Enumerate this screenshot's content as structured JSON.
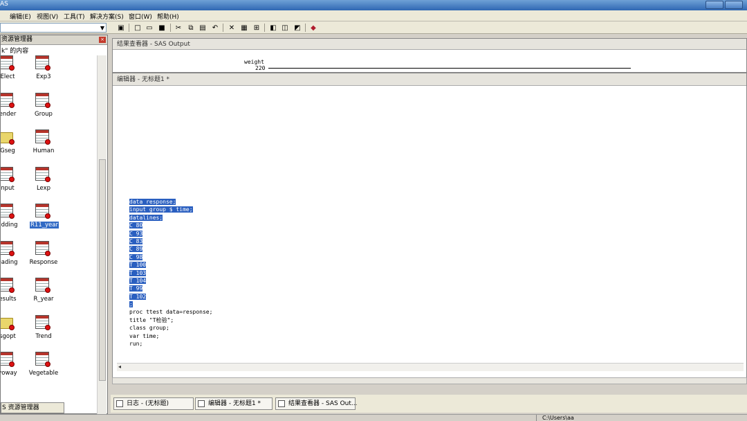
{
  "window": {
    "title": "AS"
  },
  "menu": [
    "编辑(E)",
    "视图(V)",
    "工具(T)",
    "解决方案(S)",
    "窗口(W)",
    "帮助(H)"
  ],
  "explorer": {
    "title": "资源管理器",
    "subtitle": "k\" 的内容",
    "tab": "S 资源管理器",
    "items": [
      {
        "label": "Elect",
        "icon": "table"
      },
      {
        "label": "Exp3",
        "icon": "table"
      },
      {
        "label": "ender",
        "icon": "table"
      },
      {
        "label": "Group",
        "icon": "table"
      },
      {
        "label": "Gseg",
        "icon": "folder"
      },
      {
        "label": "Human",
        "icon": "table"
      },
      {
        "label": "nput",
        "icon": "table"
      },
      {
        "label": "Lexp",
        "icon": "table"
      },
      {
        "label": "adding",
        "icon": "table"
      },
      {
        "label": "R11_year",
        "icon": "table",
        "selected": true
      },
      {
        "label": "eading",
        "icon": "table"
      },
      {
        "label": "Response",
        "icon": "table"
      },
      {
        "label": "esults",
        "icon": "table"
      },
      {
        "label": "R_year",
        "icon": "table"
      },
      {
        "label": "sgopt",
        "icon": "folder"
      },
      {
        "label": "Trend",
        "icon": "table"
      },
      {
        "label": "voway",
        "icon": "table"
      },
      {
        "label": "Vegetable",
        "icon": "table"
      }
    ]
  },
  "output_window": {
    "title": "结果查看器 - SAS Output",
    "var_label": "weight",
    "value": "220"
  },
  "editor_window": {
    "title": "编辑器 - 无标题1 *",
    "lines": [
      {
        "text": "data response;",
        "selected": true
      },
      {
        "text": "input group $ time;",
        "selected": true
      },
      {
        "text": "datalines;",
        "selected": true
      },
      {
        "text": "C 80",
        "selected": true
      },
      {
        "text": "C 93",
        "selected": true
      },
      {
        "text": "C 83",
        "selected": true
      },
      {
        "text": "C 89",
        "selected": true
      },
      {
        "text": "C 98",
        "selected": true
      },
      {
        "text": "T 100",
        "selected": true
      },
      {
        "text": "T 103",
        "selected": true
      },
      {
        "text": "T 104",
        "selected": true
      },
      {
        "text": "T 99",
        "selected": true
      },
      {
        "text": "T 102",
        "selected": true
      },
      {
        "text": ";",
        "selected": true
      },
      {
        "text": "proc ttest data=response;",
        "selected": false
      },
      {
        "text": "title \"T检验\";",
        "selected": false
      },
      {
        "text": "class group;",
        "selected": false
      },
      {
        "text": "var time;",
        "selected": false
      },
      {
        "text": "run;",
        "selected": false
      }
    ]
  },
  "taskbar": [
    {
      "label": "日志 - (无标题)"
    },
    {
      "label": "编辑器 - 无标题1 *"
    },
    {
      "label": "结果查看器 - SAS Out..."
    }
  ],
  "status": {
    "path": "C:\\Users\\aa"
  },
  "colors": {
    "selection": "#2a5fc0",
    "titlebar": "#2f67b3",
    "dataset_dot": "#dd1111"
  }
}
